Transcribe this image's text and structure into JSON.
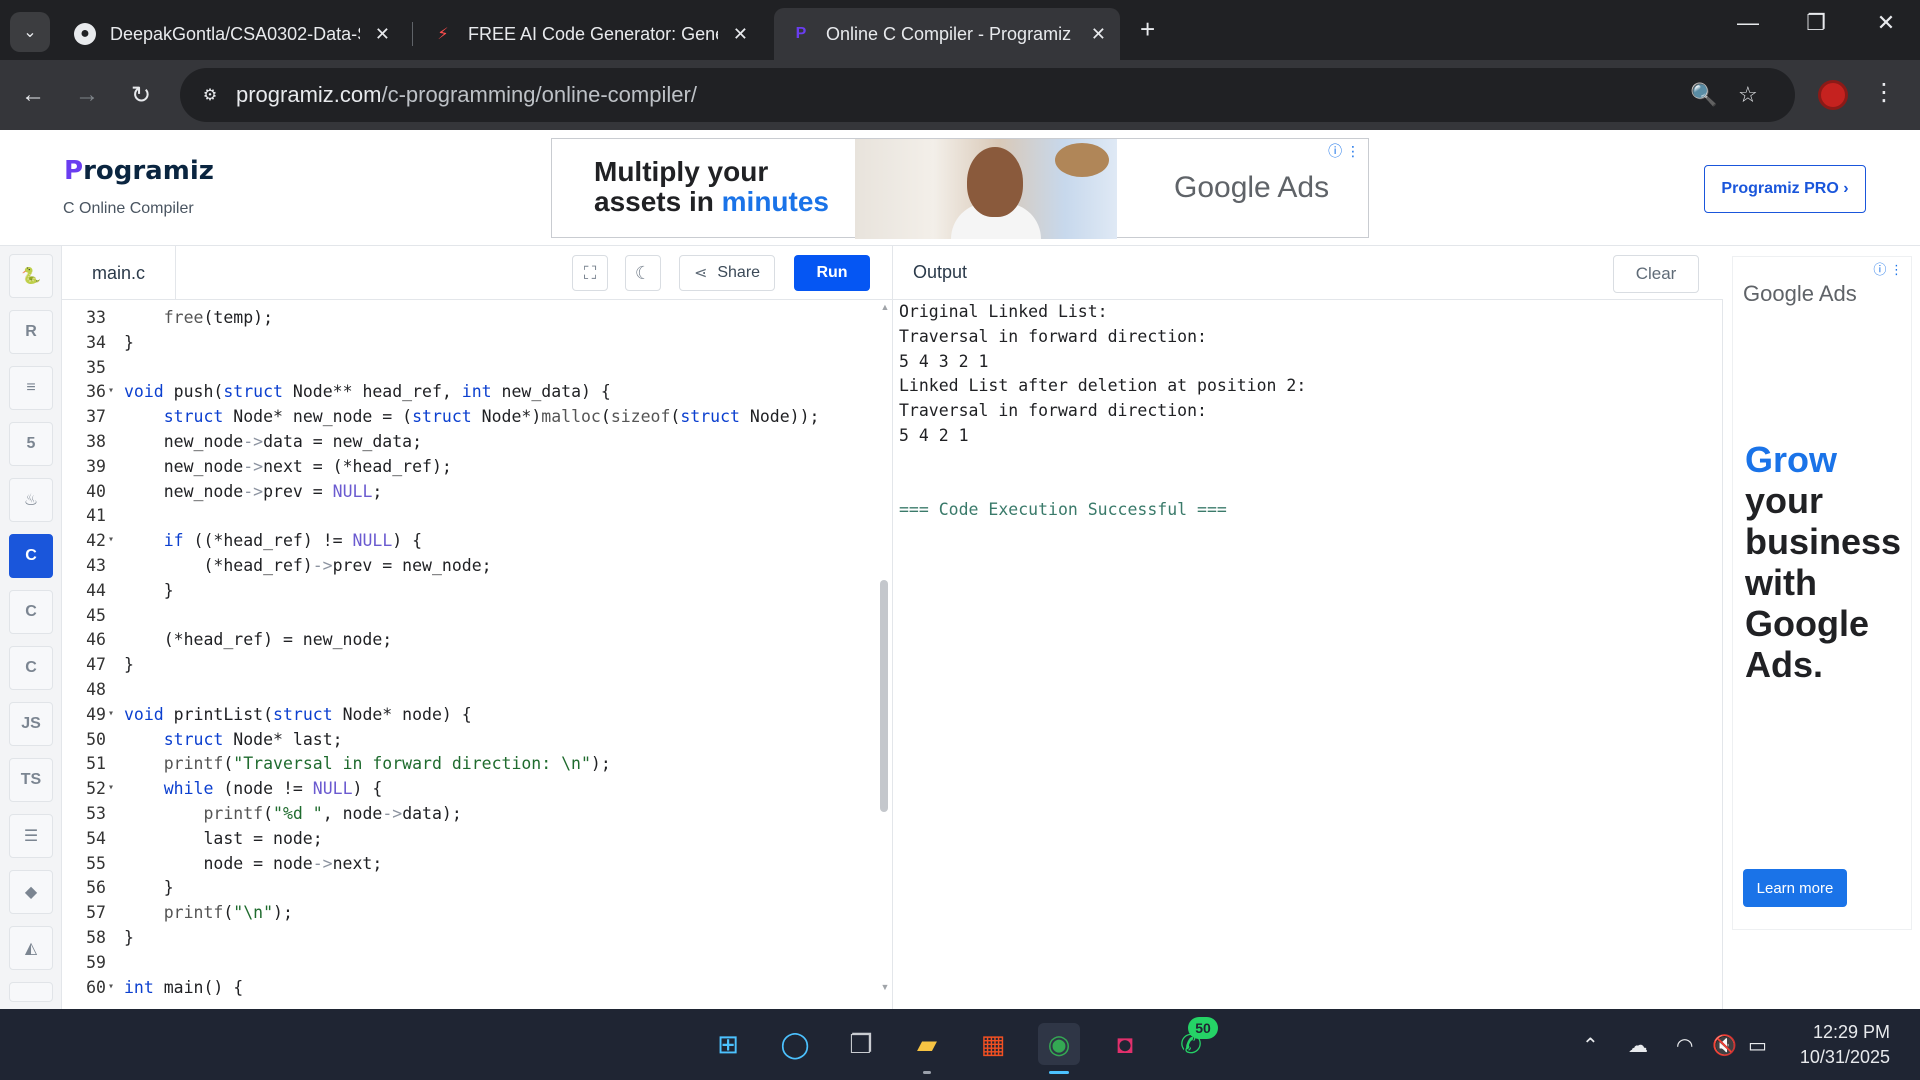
{
  "browser": {
    "tabs": [
      {
        "title": "DeepakGontla/CSA0302-Data-S",
        "icon": "github-icon"
      },
      {
        "title": "FREE AI Code Generator: Gener",
        "icon": "ai-icon"
      },
      {
        "title": "Online C Compiler - Programiz",
        "icon": "programiz-icon"
      }
    ],
    "url_host": "programiz.com",
    "url_path": "/c-programming/online-compiler/"
  },
  "site": {
    "logo": "Programiz",
    "logo_first": "P",
    "logo_rest": "rogramiz",
    "subtitle": "C Online Compiler",
    "pro_button": "Programiz PRO ›"
  },
  "top_ad": {
    "line1": "Multiply your",
    "line2_a": "assets in ",
    "line2_b": "minutes",
    "brand": "Google Ads"
  },
  "editor": {
    "filename": "main.c",
    "share_label": "Share",
    "run_label": "Run"
  },
  "code_lines": [
    {
      "n": "33",
      "fold": false
    },
    {
      "n": "34",
      "fold": false
    },
    {
      "n": "35",
      "fold": false
    },
    {
      "n": "36",
      "fold": true
    },
    {
      "n": "37",
      "fold": false
    },
    {
      "n": "38",
      "fold": false
    },
    {
      "n": "39",
      "fold": false
    },
    {
      "n": "40",
      "fold": false
    },
    {
      "n": "41",
      "fold": false
    },
    {
      "n": "42",
      "fold": true
    },
    {
      "n": "43",
      "fold": false
    },
    {
      "n": "44",
      "fold": false
    },
    {
      "n": "45",
      "fold": false
    },
    {
      "n": "46",
      "fold": false
    },
    {
      "n": "47",
      "fold": false
    },
    {
      "n": "48",
      "fold": false
    },
    {
      "n": "49",
      "fold": true
    },
    {
      "n": "50",
      "fold": false
    },
    {
      "n": "51",
      "fold": false
    },
    {
      "n": "52",
      "fold": true
    },
    {
      "n": "53",
      "fold": false
    },
    {
      "n": "54",
      "fold": false
    },
    {
      "n": "55",
      "fold": false
    },
    {
      "n": "56",
      "fold": false
    },
    {
      "n": "57",
      "fold": false
    },
    {
      "n": "58",
      "fold": false
    },
    {
      "n": "59",
      "fold": false
    },
    {
      "n": "60",
      "fold": true
    }
  ],
  "output": {
    "title": "Output",
    "clear_label": "Clear",
    "lines": [
      "Original Linked List:",
      "Traversal in forward direction:",
      "5 4 3 2 1",
      "Linked List after deletion at position 2:",
      "Traversal in forward direction:",
      "5 4 2 1",
      "",
      "",
      "=== Code Execution Successful ==="
    ]
  },
  "side_ad": {
    "brand": "Google Ads",
    "headline_grow": "Grow",
    "headline_rest": "your business with Google Ads.",
    "button": "Learn more"
  },
  "taskbar": {
    "time": "12:29 PM",
    "date": "10/31/2025",
    "whatsapp_badge": "50"
  }
}
